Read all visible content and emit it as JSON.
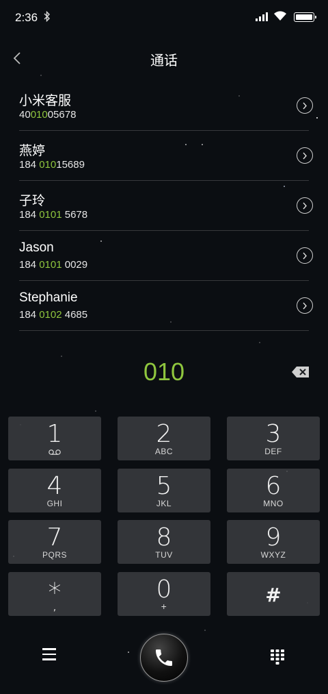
{
  "status_bar": {
    "time": "2:36",
    "icons": [
      "bluetooth-icon",
      "signal-icon",
      "wifi-icon",
      "battery-icon"
    ]
  },
  "header": {
    "title": "通话",
    "back_icon": "chevron-left-icon"
  },
  "contacts": [
    {
      "name": "小米客服",
      "number_pre": "40",
      "number_match": "010",
      "number_post": "05678"
    },
    {
      "name": "燕婷",
      "number_pre": "184 ",
      "number_match": "010",
      "number_post": "15689"
    },
    {
      "name": "子玲",
      "number_pre": "184 ",
      "number_match": "0101",
      "number_post": " 5678"
    },
    {
      "name": "Jason",
      "number_pre": "184 ",
      "number_match": "0101",
      "number_post": " 0029"
    },
    {
      "name": "Stephanie",
      "number_pre": "184 ",
      "number_match": "0102",
      "number_post": " 4685"
    }
  ],
  "dial": {
    "input": "010",
    "backspace_icon": "backspace-icon"
  },
  "keypad": [
    {
      "digit": "1",
      "letters": ""
    },
    {
      "digit": "2",
      "letters": "ABC"
    },
    {
      "digit": "3",
      "letters": "DEF"
    },
    {
      "digit": "4",
      "letters": "GHI"
    },
    {
      "digit": "5",
      "letters": "JKL"
    },
    {
      "digit": "6",
      "letters": "MNO"
    },
    {
      "digit": "7",
      "letters": "PQRS"
    },
    {
      "digit": "8",
      "letters": "TUV"
    },
    {
      "digit": "9",
      "letters": "WXYZ"
    },
    {
      "digit": "*",
      "letters": ","
    },
    {
      "digit": "0",
      "letters": "+"
    },
    {
      "digit": "#",
      "letters": ""
    }
  ],
  "bottom_bar": {
    "menu_icon": "hamburger-menu-icon",
    "call_icon": "phone-icon",
    "dialpad_icon": "dialpad-icon"
  },
  "colors": {
    "accent_green": "#8fc63e",
    "background": "#0b0e12",
    "key_background": "#3c3e42"
  }
}
